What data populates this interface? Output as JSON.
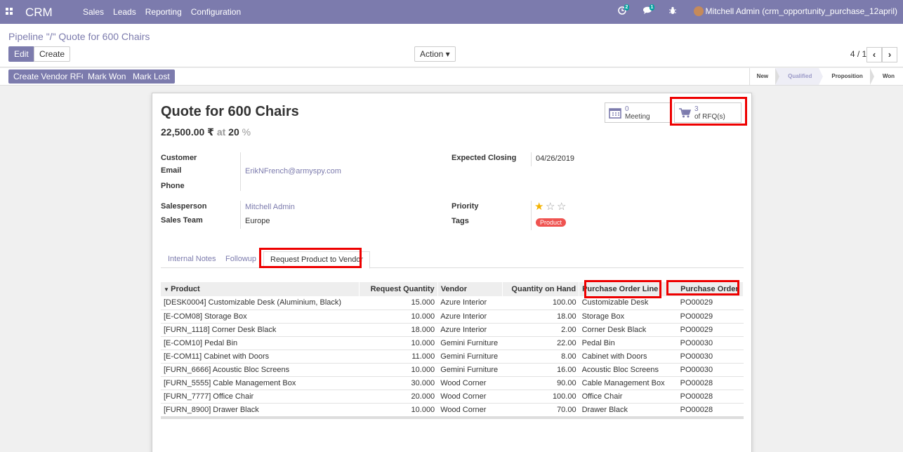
{
  "navbar": {
    "brand": "CRM",
    "menu": [
      "Sales",
      "Leads",
      "Reporting",
      "Configuration"
    ],
    "activity_count": "2",
    "message_count": "1",
    "user": "Mitchell Admin (crm_opportunity_purchase_12april)"
  },
  "control": {
    "breadcrumb": "Pipeline \"/\" Quote for 600 Chairs",
    "edit": "Edit",
    "create": "Create",
    "action": "Action ▾",
    "pager": "4 / 11",
    "prev": "‹",
    "next": "›"
  },
  "statusbar": {
    "buttons": [
      "Create Vendor RFQ",
      "Mark Won",
      "Mark Lost"
    ],
    "stages": [
      "New",
      "Qualified",
      "Proposition",
      "Won"
    ]
  },
  "record": {
    "title": "Quote for 600 Chairs",
    "amount": "22,500.00 ₹",
    "at": "at",
    "probability": "20",
    "pct": "%"
  },
  "smart_buttons": {
    "meeting_count": "0",
    "meeting_label": "Meeting",
    "rfq_count": "3",
    "rfq_label": "of RFQ(s)"
  },
  "fields": {
    "customer_label": "Customer",
    "email_label": "Email",
    "email": "ErikNFrench@armyspy.com",
    "phone_label": "Phone",
    "expected_closing_label": "Expected Closing",
    "expected_closing": "04/26/2019",
    "salesperson_label": "Salesperson",
    "salesperson": "Mitchell Admin",
    "sales_team_label": "Sales Team",
    "sales_team": "Europe",
    "priority_label": "Priority",
    "priority": "1 of 3 stars",
    "tags_label": "Tags",
    "tag": "Product"
  },
  "tabs": [
    "Internal Notes",
    "Followup",
    "Request Product to Vendor"
  ],
  "table": {
    "columns": [
      "Product",
      "Request Quantity",
      "Vendor",
      "Quantity on Hand",
      "Purchase Order Line",
      "Purchase Order"
    ],
    "rows": [
      [
        "[DESK0004] Customizable Desk (Aluminium, Black)",
        "15.000",
        "Azure Interior",
        "100.00",
        "Customizable Desk",
        "PO00029"
      ],
      [
        "[E-COM08] Storage Box",
        "10.000",
        "Azure Interior",
        "18.00",
        "Storage Box",
        "PO00029"
      ],
      [
        "[FURN_1118] Corner Desk Black",
        "18.000",
        "Azure Interior",
        "2.00",
        "Corner Desk Black",
        "PO00029"
      ],
      [
        "[E-COM10] Pedal Bin",
        "10.000",
        "Gemini Furniture",
        "22.00",
        "Pedal Bin",
        "PO00030"
      ],
      [
        "[E-COM11] Cabinet with Doors",
        "11.000",
        "Gemini Furniture",
        "8.00",
        "Cabinet with Doors",
        "PO00030"
      ],
      [
        "[FURN_6666] Acoustic Bloc Screens",
        "10.000",
        "Gemini Furniture",
        "16.00",
        "Acoustic Bloc Screens",
        "PO00030"
      ],
      [
        "[FURN_5555] Cable Management Box",
        "30.000",
        "Wood Corner",
        "90.00",
        "Cable Management Box",
        "PO00028"
      ],
      [
        "[FURN_7777] Office Chair",
        "20.000",
        "Wood Corner",
        "100.00",
        "Office Chair",
        "PO00028"
      ],
      [
        "[FURN_8900] Drawer Black",
        "10.000",
        "Wood Corner",
        "70.00",
        "Drawer Black",
        "PO00028"
      ]
    ]
  },
  "colors": {
    "brand": "#7c7bad",
    "highlight": "#e00000",
    "tag": "#ef5350"
  }
}
